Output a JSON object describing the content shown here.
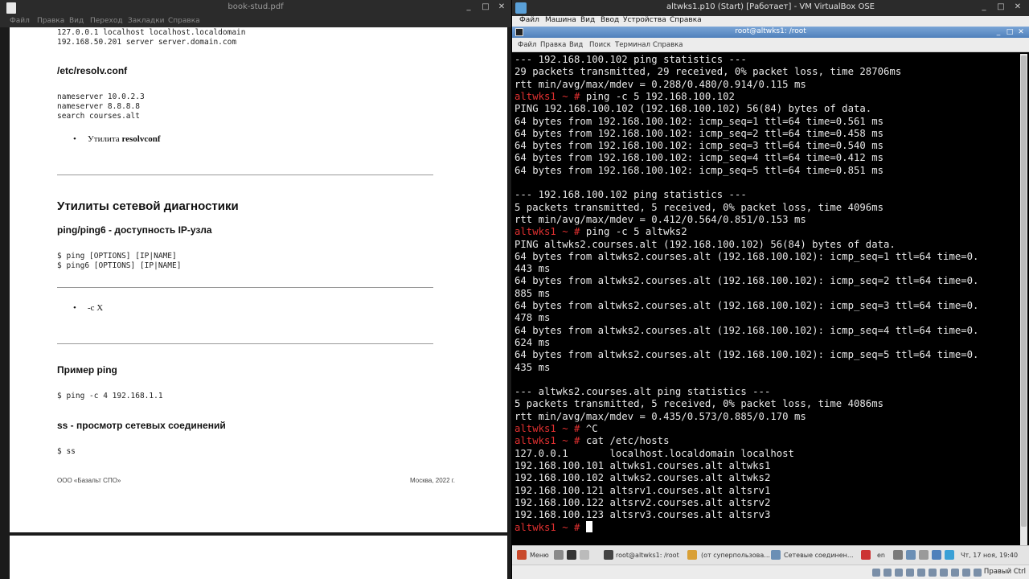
{
  "pdf": {
    "title": "book-stud.pdf",
    "menu": [
      "Файл",
      "Правка",
      "Вид",
      "Переход",
      "Закладки",
      "Справка"
    ],
    "hosts_lines": "127.0.0.1 localhost localhost.localdomain\n192.168.50.201 server server.domain.com",
    "resolv_heading": "/etc/resolv.conf",
    "resolv_lines": "nameserver 10.0.2.3\nnameserver 8.8.8.8\nsearch courses.alt",
    "bullet1_prefix": "Утилита ",
    "bullet1_bold": "resolvconf",
    "section_title": "Утилиты сетевой диагностики",
    "ping_heading": "ping/ping6 - доступность IP-узла",
    "ping_usage": "$ ping [OPTIONS] [IP|NAME]\n$ ping6 [OPTIONS] [IP|NAME]",
    "bullet2": "-c X",
    "example_heading": "Пример ping",
    "example_cmd": "$ ping -c 4 192.168.1.1",
    "ss_heading": "ss - просмотр сетевых соединений",
    "ss_cmd": "$ ss",
    "footer_left": "ООО «Базальт СПО»",
    "footer_right": "Москва, 2022 г.",
    "bullet_char": "•"
  },
  "vbox": {
    "title": "altwks1.p10 (Start) [Работает] - VM VirtualBox OSE",
    "menu": [
      "Файл",
      "Машина",
      "Вид",
      "Ввод",
      "Устройства",
      "Справка"
    ],
    "host_key": "Правый Ctrl"
  },
  "terminal": {
    "title": "root@altwks1: /root",
    "menu": [
      "Файл",
      "Правка",
      "Вид",
      "Поиск",
      "Терминал",
      "Справка"
    ],
    "prompt": "altwks1 ~ # ",
    "lines": [
      {
        "t": "--- 192.168.100.102 ping statistics ---"
      },
      {
        "t": "29 packets transmitted, 29 received, 0% packet loss, time 28706ms"
      },
      {
        "t": "rtt min/avg/max/mdev = 0.288/0.480/0.914/0.115 ms"
      },
      {
        "p": true,
        "t": "ping -c 5 192.168.100.102"
      },
      {
        "t": "PING 192.168.100.102 (192.168.100.102) 56(84) bytes of data."
      },
      {
        "t": "64 bytes from 192.168.100.102: icmp_seq=1 ttl=64 time=0.561 ms"
      },
      {
        "t": "64 bytes from 192.168.100.102: icmp_seq=2 ttl=64 time=0.458 ms"
      },
      {
        "t": "64 bytes from 192.168.100.102: icmp_seq=3 ttl=64 time=0.540 ms"
      },
      {
        "t": "64 bytes from 192.168.100.102: icmp_seq=4 ttl=64 time=0.412 ms"
      },
      {
        "t": "64 bytes from 192.168.100.102: icmp_seq=5 ttl=64 time=0.851 ms"
      },
      {
        "t": ""
      },
      {
        "t": "--- 192.168.100.102 ping statistics ---"
      },
      {
        "t": "5 packets transmitted, 5 received, 0% packet loss, time 4096ms"
      },
      {
        "t": "rtt min/avg/max/mdev = 0.412/0.564/0.851/0.153 ms"
      },
      {
        "p": true,
        "t": "ping -c 5 altwks2"
      },
      {
        "t": "PING altwks2.courses.alt (192.168.100.102) 56(84) bytes of data."
      },
      {
        "t": "64 bytes from altwks2.courses.alt (192.168.100.102): icmp_seq=1 ttl=64 time=0."
      },
      {
        "t": "443 ms"
      },
      {
        "t": "64 bytes from altwks2.courses.alt (192.168.100.102): icmp_seq=2 ttl=64 time=0."
      },
      {
        "t": "885 ms"
      },
      {
        "t": "64 bytes from altwks2.courses.alt (192.168.100.102): icmp_seq=3 ttl=64 time=0."
      },
      {
        "t": "478 ms"
      },
      {
        "t": "64 bytes from altwks2.courses.alt (192.168.100.102): icmp_seq=4 ttl=64 time=0."
      },
      {
        "t": "624 ms"
      },
      {
        "t": "64 bytes from altwks2.courses.alt (192.168.100.102): icmp_seq=5 ttl=64 time=0."
      },
      {
        "t": "435 ms"
      },
      {
        "t": ""
      },
      {
        "t": "--- altwks2.courses.alt ping statistics ---"
      },
      {
        "t": "5 packets transmitted, 5 received, 0% packet loss, time 4086ms"
      },
      {
        "t": "rtt min/avg/max/mdev = 0.435/0.573/0.885/0.170 ms"
      },
      {
        "p": true,
        "t": "^C"
      },
      {
        "p": true,
        "t": "cat /etc/hosts"
      },
      {
        "t": "127.0.0.1       localhost.localdomain localhost"
      },
      {
        "t": "192.168.100.101 altwks1.courses.alt altwks1"
      },
      {
        "t": "192.168.100.102 altwks2.courses.alt altwks2"
      },
      {
        "t": "192.168.100.121 altsrv1.courses.alt altsrv1"
      },
      {
        "t": "192.168.100.122 altsrv2.courses.alt altsrv2"
      },
      {
        "t": "192.168.100.123 altsrv3.courses.alt altsrv3"
      },
      {
        "p": true,
        "t": "",
        "cursor": true
      }
    ]
  },
  "taskbar": {
    "menu_label": "Меню",
    "tasks": [
      "root@altwks1: /root",
      "(от суперпользова...",
      "Сетевые соединен..."
    ],
    "lang": "en",
    "clock": "Чт, 17 ноя, 19:40"
  }
}
